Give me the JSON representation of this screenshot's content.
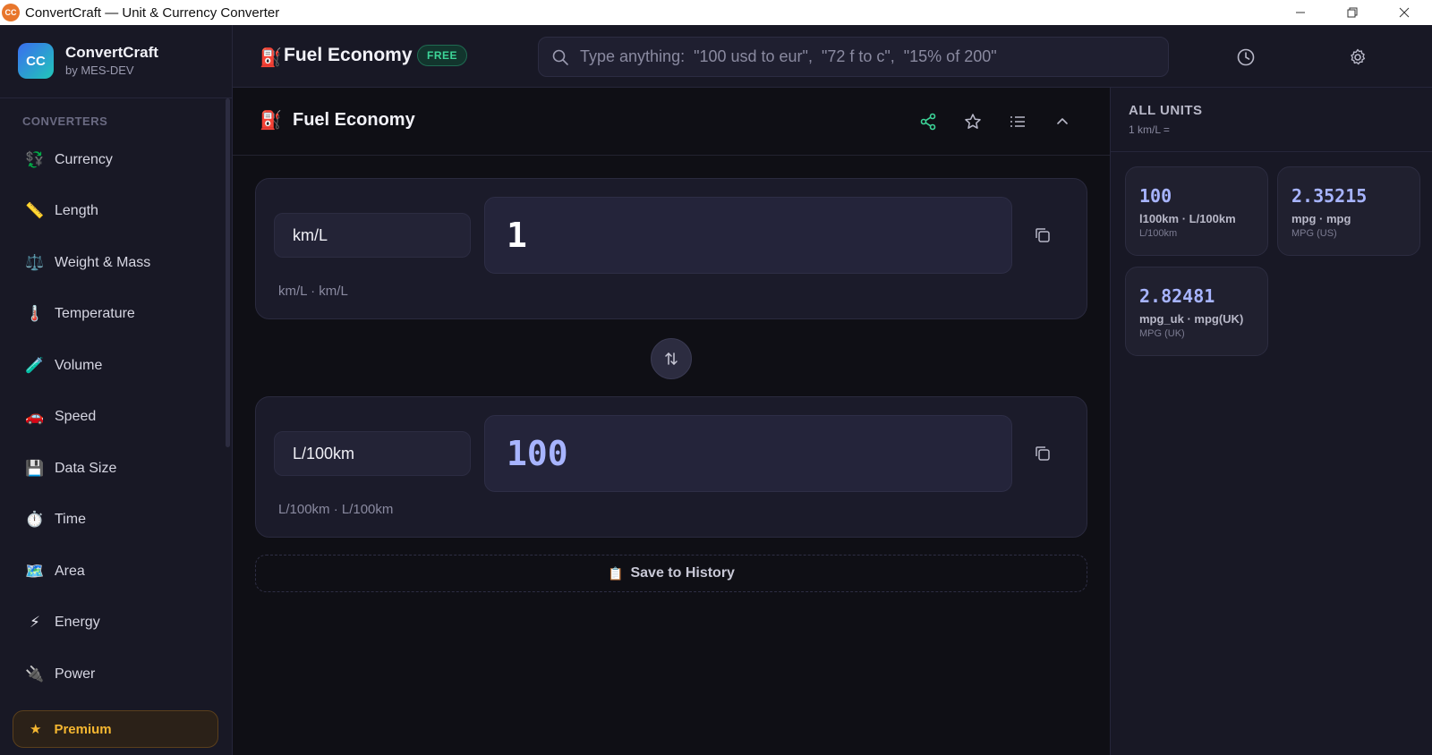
{
  "window": {
    "title": "ConvertCraft — Unit & Currency Converter",
    "app_icon_text": "CC"
  },
  "brand": {
    "logo_text": "CC",
    "name": "ConvertCraft",
    "byline": "by MES-DEV"
  },
  "sidebar": {
    "section_label": "CONVERTERS",
    "items": [
      {
        "label": "Currency",
        "icon": "currency-exchange-icon",
        "glyph": "💱"
      },
      {
        "label": "Length",
        "icon": "ruler-icon",
        "glyph": "📏"
      },
      {
        "label": "Weight & Mass",
        "icon": "scale-icon",
        "glyph": "⚖️"
      },
      {
        "label": "Temperature",
        "icon": "thermometer-icon",
        "glyph": "🌡️"
      },
      {
        "label": "Volume",
        "icon": "test-tube-icon",
        "glyph": "🧪"
      },
      {
        "label": "Speed",
        "icon": "car-icon",
        "glyph": "🚗"
      },
      {
        "label": "Data Size",
        "icon": "floppy-disk-icon",
        "glyph": "💾"
      },
      {
        "label": "Time",
        "icon": "stopwatch-icon",
        "glyph": "⏱️"
      },
      {
        "label": "Area",
        "icon": "map-icon",
        "glyph": "🗺️"
      },
      {
        "label": "Energy",
        "icon": "lightning-icon",
        "glyph": "⚡"
      },
      {
        "label": "Power",
        "icon": "plug-icon",
        "glyph": "🔌"
      }
    ],
    "premium": {
      "label": "Premium",
      "star": "★"
    }
  },
  "header": {
    "icon_glyph": "⛽",
    "title": "Fuel Economy",
    "badge": "FREE",
    "search_placeholder": "Type anything:  \"100 usd to eur\",  \"72 f to c\",  \"15% of 200\""
  },
  "panel": {
    "icon_glyph": "⛽",
    "title": "Fuel Economy"
  },
  "converter": {
    "from": {
      "unit": "km/L",
      "value": "1",
      "subtitle": "km/L · km/L"
    },
    "to": {
      "unit": "L/100km",
      "value": "100",
      "subtitle": "L/100km · L/100km"
    },
    "save_label": "Save to History",
    "save_icon": "📋"
  },
  "all_units": {
    "title": "ALL UNITS",
    "subtitle": "1 km/L =",
    "cards": [
      {
        "value": "100",
        "name": "l100km · L/100km",
        "desc": "L/100km"
      },
      {
        "value": "2.35215",
        "name": "mpg · mpg",
        "desc": "MPG (US)"
      },
      {
        "value": "2.82481",
        "name": "mpg_uk · mpg(UK)",
        "desc": "MPG (UK)"
      }
    ]
  },
  "colors": {
    "accent": "#a7b4ff",
    "share_green": "#3dd598",
    "premium_gold": "#f5b731"
  }
}
